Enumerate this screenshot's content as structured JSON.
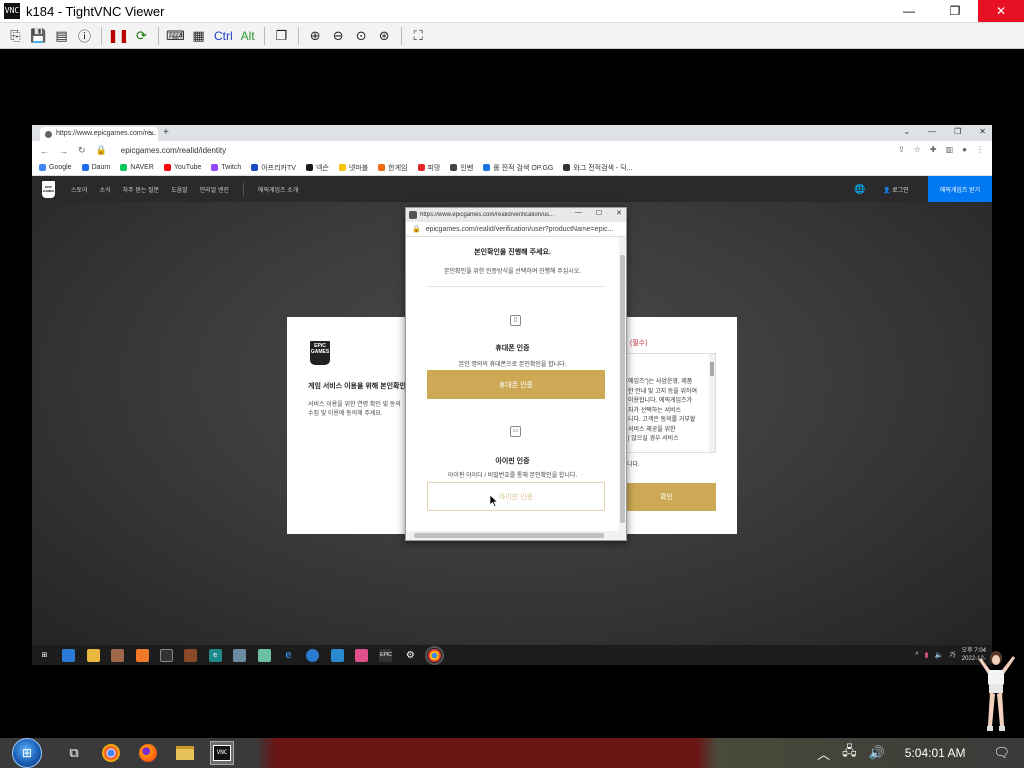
{
  "vnc": {
    "title": "k184 - TightVNC Viewer",
    "toolbar_text": {
      "ctrl": "Ctrl",
      "alt": "Alt"
    },
    "window_controls": [
      "—",
      "❐",
      "✕"
    ]
  },
  "browser": {
    "tab_title": "https://www.epicgames.com/re...",
    "tab_close": "×",
    "new_tab": "+",
    "url": "epicgames.com/realid/identity",
    "bookmarks": [
      {
        "label": "Google",
        "color": "#4285f4"
      },
      {
        "label": "Daum",
        "color": "#1e6cf0"
      },
      {
        "label": "NAVER",
        "color": "#03c75a"
      },
      {
        "label": "YouTube",
        "color": "#ff0000"
      },
      {
        "label": "Twitch",
        "color": "#9146ff"
      },
      {
        "label": "아프리카TV",
        "color": "#1a4cc0"
      },
      {
        "label": "넥슨",
        "color": "#1a1a1a"
      },
      {
        "label": "넷마블",
        "color": "#f7c600"
      },
      {
        "label": "한게임",
        "color": "#f06b16"
      },
      {
        "label": "피망",
        "color": "#e6242a"
      },
      {
        "label": "인벤",
        "color": "#444444"
      },
      {
        "label": "롤 전적 검색 OP.GG",
        "color": "#1a73e8"
      },
      {
        "label": "와그 전적검색 - 딕...",
        "color": "#333333"
      }
    ]
  },
  "epic_nav": {
    "logo": "EPIC GAMES",
    "items": [
      "스토어",
      "소식",
      "자주 묻는 질문",
      "도움말",
      "언리얼 엔진"
    ],
    "extra": "에픽게임즈 소개",
    "login": "로그인",
    "download": "에픽게임즈 받기"
  },
  "card": {
    "logo": "EPIC GAMES",
    "heading": "게임 서비스 이용을 위해 본인확인을",
    "desc_lines": [
      "서비스 이용을 위한 연령 확인 및 동의",
      "수집 및 이용에 동의해 주세요."
    ],
    "required": "(필수)",
    "terms_lines": [
      "에임즈\")는 사업운영, 제품",
      "안 안내 및 고지 등을 위하여",
      "이용합니다. 에픽게임즈가",
      "자가 선택하는 서비스",
      "니다. 고객은 동의를 거부할",
      "서비스 제공을 위한",
      "| 않으실 경우 서비스"
    ],
    "note": "니다.",
    "confirm": "확인"
  },
  "popup": {
    "title": "https://www.epicgames.com/realid/verification/us...",
    "window_controls": [
      "—",
      "☐",
      "✕"
    ],
    "url": "epicgames.com/realid/verification/user?productName=epic...",
    "heading": "본인확인을 진행해 주세요.",
    "subheading": "본인확인을 위한 인증방식을 선택하여 진행해 주십시오.",
    "phone": {
      "label": "휴대폰 인증",
      "desc": "본인 명의의 휴대폰으로 본인확인을 합니다.",
      "button": "휴대폰 인증"
    },
    "ipin": {
      "label": "아이핀 인증",
      "desc": "아이핀 아이디 / 비밀번호를 통해 본인확인을 합니다.",
      "button": "아이핀 인증"
    }
  },
  "remote_taskbar": {
    "clock_time": "오후 7:04",
    "clock_date": "2022-12-"
  },
  "local_taskbar": {
    "clock": "5:04:01 AM"
  }
}
